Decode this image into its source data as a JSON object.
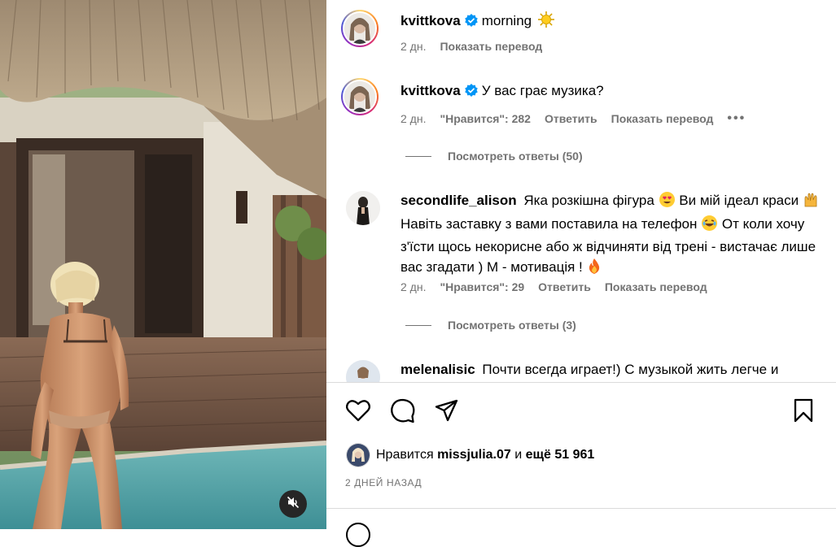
{
  "media": {
    "mute_icon": "speaker-muted-icon"
  },
  "comments": [
    {
      "username": "kvittkova",
      "verified": true,
      "text": "morning",
      "emoji": "sun-emoji",
      "time": "2 дн.",
      "translate": "Показать перевод"
    },
    {
      "username": "kvittkova",
      "verified": true,
      "text": "У вас грає музика?",
      "time": "2 дн.",
      "likes": "\"Нравится\": 282",
      "reply": "Ответить",
      "translate": "Показать перевод",
      "more": "•••",
      "view_replies": "Посмотреть ответы (50)"
    },
    {
      "username": "secondlife_alison",
      "verified": false,
      "text_part1": "Яка розкішна фігура",
      "text_part2": "Ви мій ідеал краси",
      "text_part3": "Навіть заставку з вами поставила на телефон",
      "text_part4": "От коли хочу з'їсти щось некорисне або ж відчиняти від трені - вистачає лише вас згадати ) М - мотивація !",
      "time": "2 дн.",
      "likes": "\"Нравится\": 29",
      "reply": "Ответить",
      "translate": "Показать перевод",
      "view_replies": "Посмотреть ответы (3)"
    },
    {
      "username": "melenalisic",
      "verified": false,
      "text": "Почти всегда играет!) С музыкой жить легче и"
    }
  ],
  "actions": {
    "like_icon": "heart-icon",
    "comment_icon": "comment-icon",
    "share_icon": "send-icon",
    "save_icon": "bookmark-icon"
  },
  "likes": {
    "prefix": "Нравится",
    "user": "missjulia.07",
    "conj": "и",
    "rest": "ещё 51 961"
  },
  "date": "2 ДНЕЙ НАЗАД",
  "colors": {
    "verified": "#0095f6",
    "secondary_text": "#737373",
    "divider": "#dbdbdb"
  }
}
